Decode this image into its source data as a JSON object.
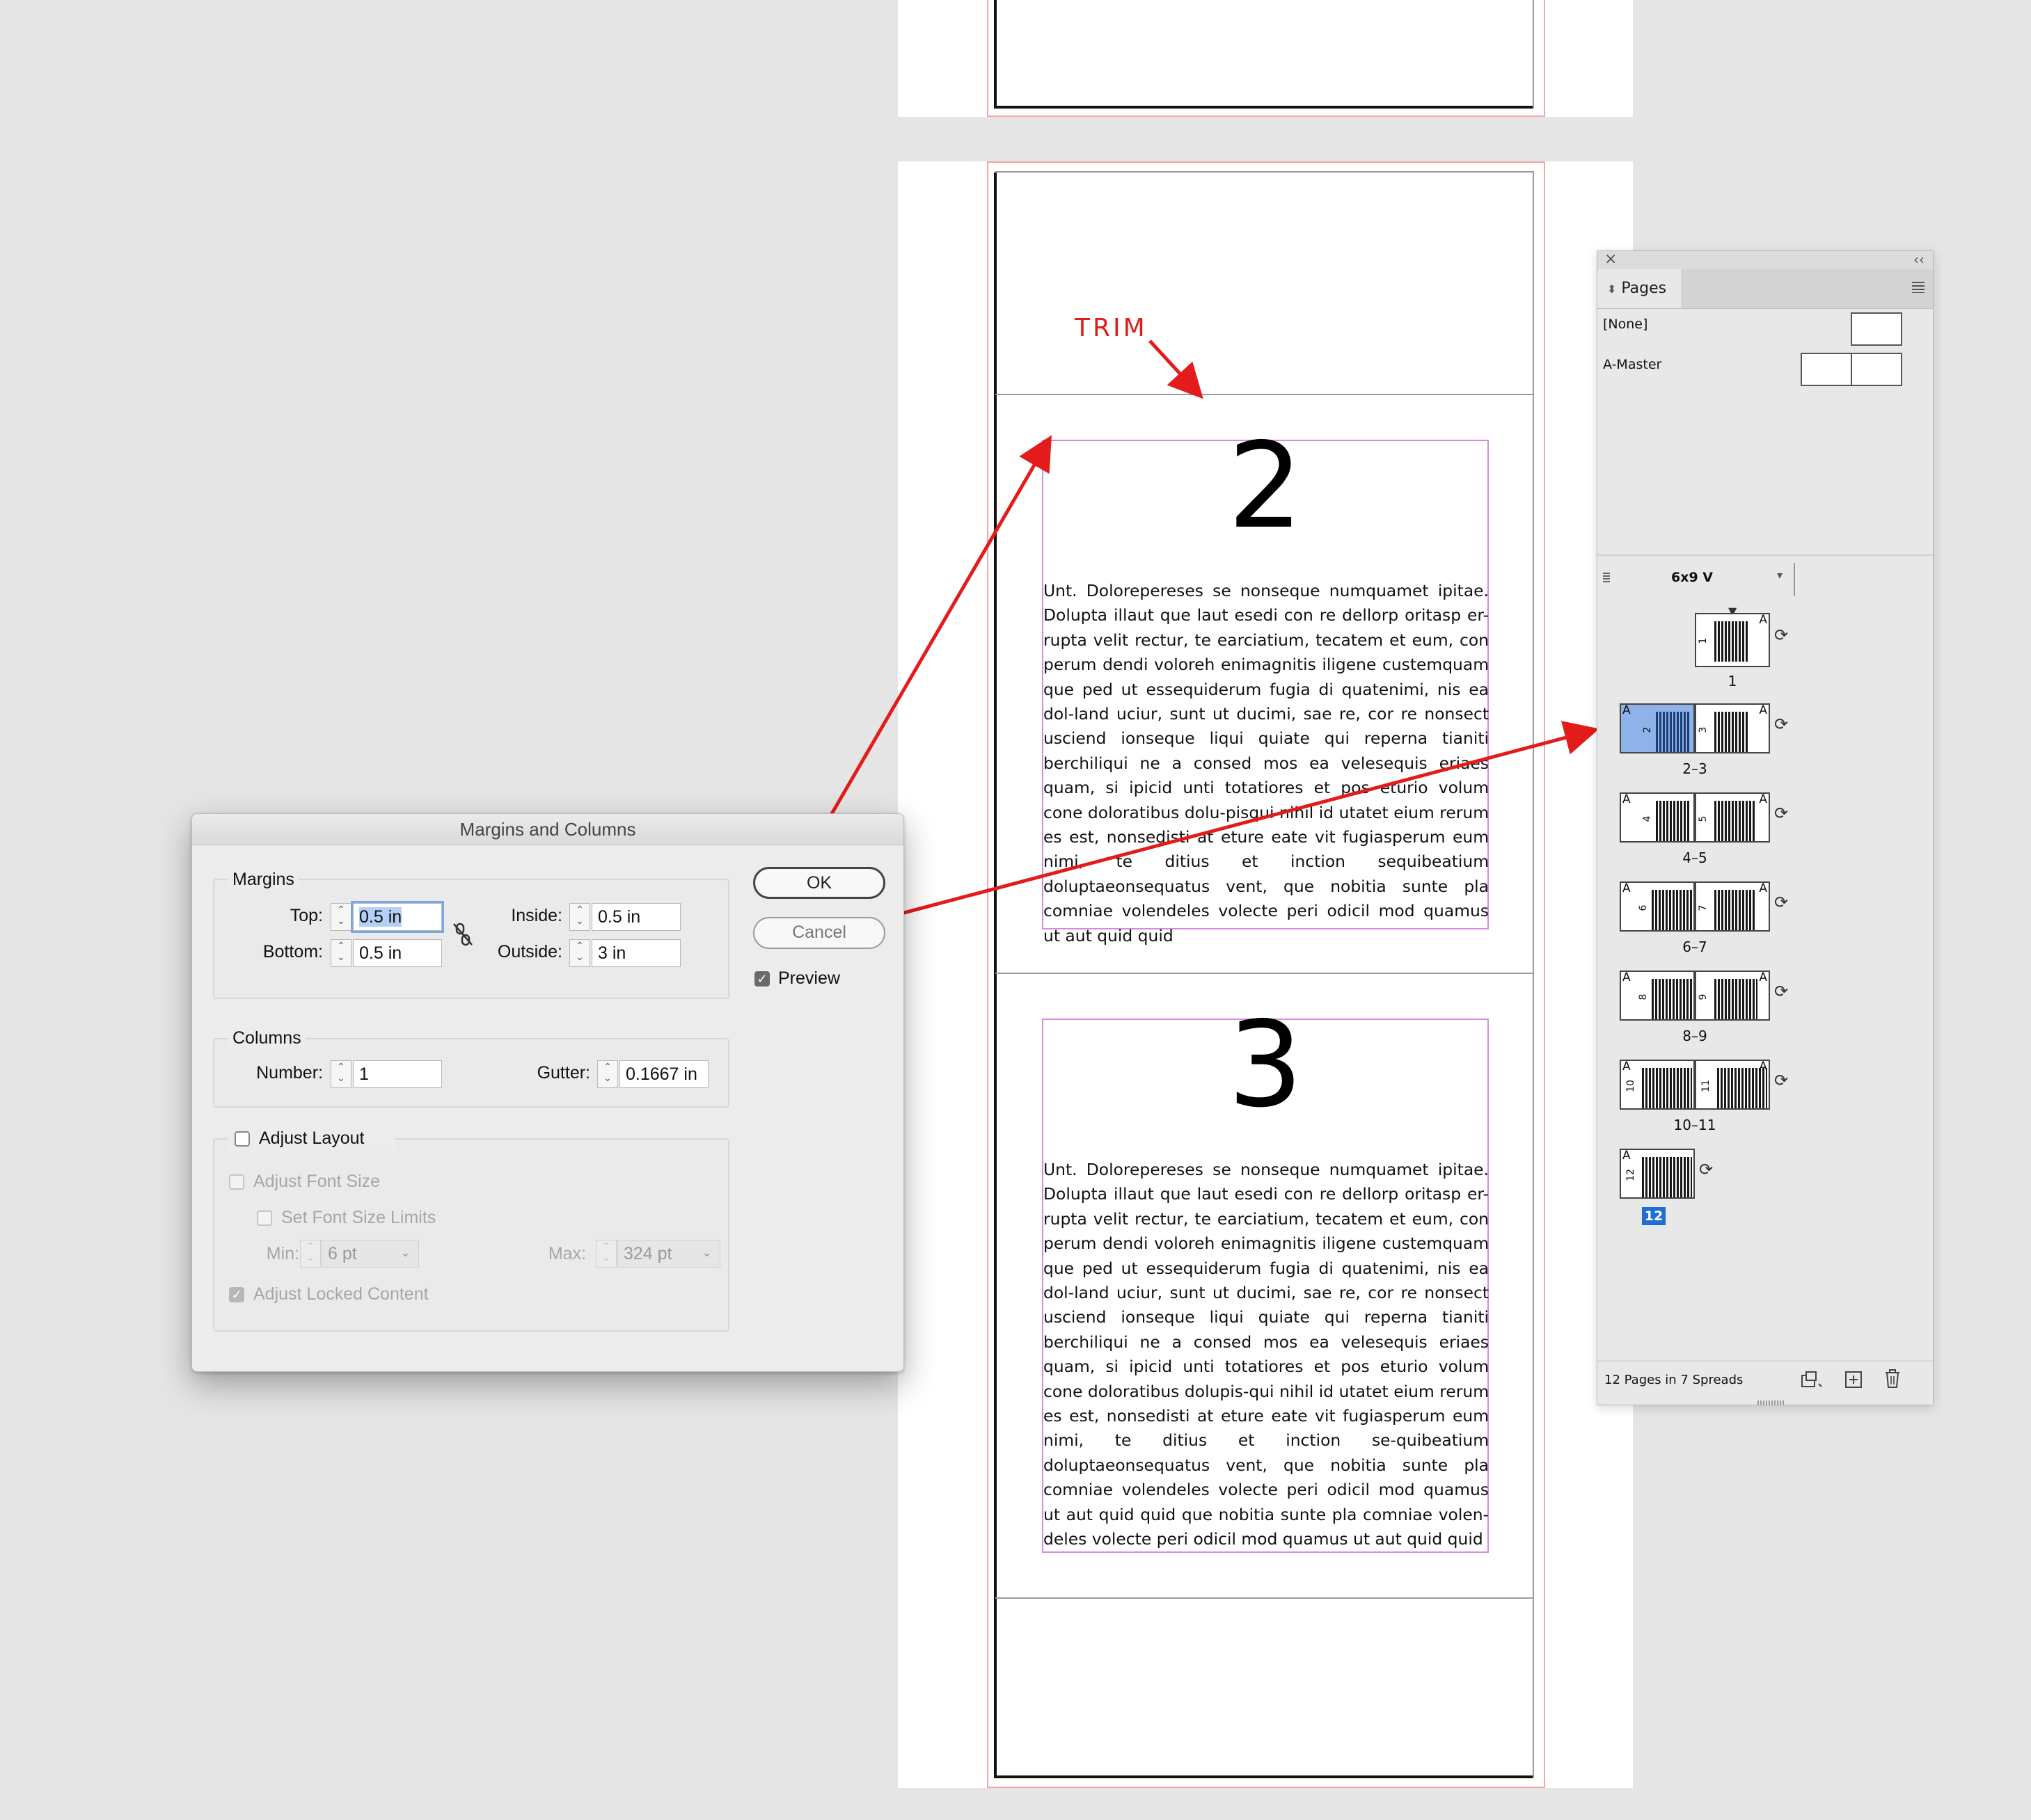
{
  "annotation": {
    "trim_label": "TRIM"
  },
  "document": {
    "page2": {
      "number": "2",
      "text": "Unt. Dolorepere­ses se nonseque numquamet ipitae. Dolupta illaut que laut esedi con re dellorp oritasp er-rupta velit rectur, te earciatium, tecatem et eum, con perum dendi voloreh enimagnitis iligene custemquam que ped ut essequiderum fugia di quatenimi, nis ea dol-land uciur, sunt ut ducimi, sae re, cor re nonsect usciend ionseque liqui quiate qui reperna tianiti berchiliqui ne a consed mos ea velesequis eriaes quam, si ipicid unti totatiores et pos eturio volum cone doloratibus dolu-pisqui nihil id utatet eium rerum es est, nonsedisti at eture eate vit fugiasperum eum nimi, te ditius et inction sequibeatium doluptaeonsequatus vent, que nobitia sunte pla comniae volendeles volecte peri odicil mod quamus ut aut quid quid"
    },
    "page3": {
      "number": "3",
      "text": "Unt. Dolorepere­ses se nonseque numquamet ipitae. Dolupta illaut que laut esedi con re dellorp oritasp er-rupta velit rectur, te earciatium, tecatem et eum, con perum dendi voloreh enimagnitis iligene custemquam que ped ut essequiderum fugia di quatenimi, nis ea dol-land uciur, sunt ut ducimi, sae re, cor re nonsect usciend ionseque liqui quiate qui reperna tianiti berchiliqui ne a consed mos ea velesequis eriaes quam, si ipicid unti totatiores et pos eturio volum cone doloratibus dolupis-qui nihil id utatet eium rerum es est, nonsedisti at eture eate vit fugiasperum eum nimi, te ditius et inction se-quibeatium doluptaeonsequatus vent, que nobitia sunte pla comniae volendeles volecte peri odicil mod quamus ut aut quid quid que nobitia sunte pla comniae volen-deles volecte peri odicil mod quamus ut aut quid quid"
    }
  },
  "dialog": {
    "title": "Margins and Columns",
    "margins": {
      "title": "Margins",
      "top_label": "Top:",
      "top_value": "0.5 in",
      "bottom_label": "Bottom:",
      "bottom_value": "0.5 in",
      "inside_label": "Inside:",
      "inside_value": "0.5 in",
      "outside_label": "Outside:",
      "outside_value": "3 in"
    },
    "columns": {
      "title": "Columns",
      "number_label": "Number:",
      "number_value": "1",
      "gutter_label": "Gutter:",
      "gutter_value": "0.1667 in"
    },
    "adjust_layout": {
      "label": "Adjust Layout",
      "checked": false,
      "font_size_label": "Adjust Font Size",
      "font_limits_label": "Set Font Size Limits",
      "min_label": "Min:",
      "min_value": "6 pt",
      "max_label": "Max:",
      "max_value": "324 pt",
      "locked_label": "Adjust Locked Content"
    },
    "ok_label": "OK",
    "cancel_label": "Cancel",
    "preview_label": "Preview"
  },
  "pages_panel": {
    "close_glyph": "×",
    "collapse_glyph": "‹‹",
    "tab_label": "Pages",
    "none_label": "[None]",
    "master_label": "A-Master",
    "size_label": "6x9 V",
    "spreads": [
      {
        "label": "1",
        "left": null,
        "right": "1"
      },
      {
        "label": "2–3",
        "left": "2",
        "right": "3"
      },
      {
        "label": "4–5",
        "left": "4",
        "right": "5"
      },
      {
        "label": "6–7",
        "left": "6",
        "right": "7"
      },
      {
        "label": "8–9",
        "left": "8",
        "right": "9"
      },
      {
        "label": "10–11",
        "left": "10",
        "right": "11"
      },
      {
        "label": "12",
        "left": "12",
        "right": null
      }
    ],
    "master_prefix": "A",
    "footer": "12 Pages in 7 Spreads"
  },
  "colors": {
    "annotation": "#e31b1b",
    "selection": "#1d6fd6"
  }
}
